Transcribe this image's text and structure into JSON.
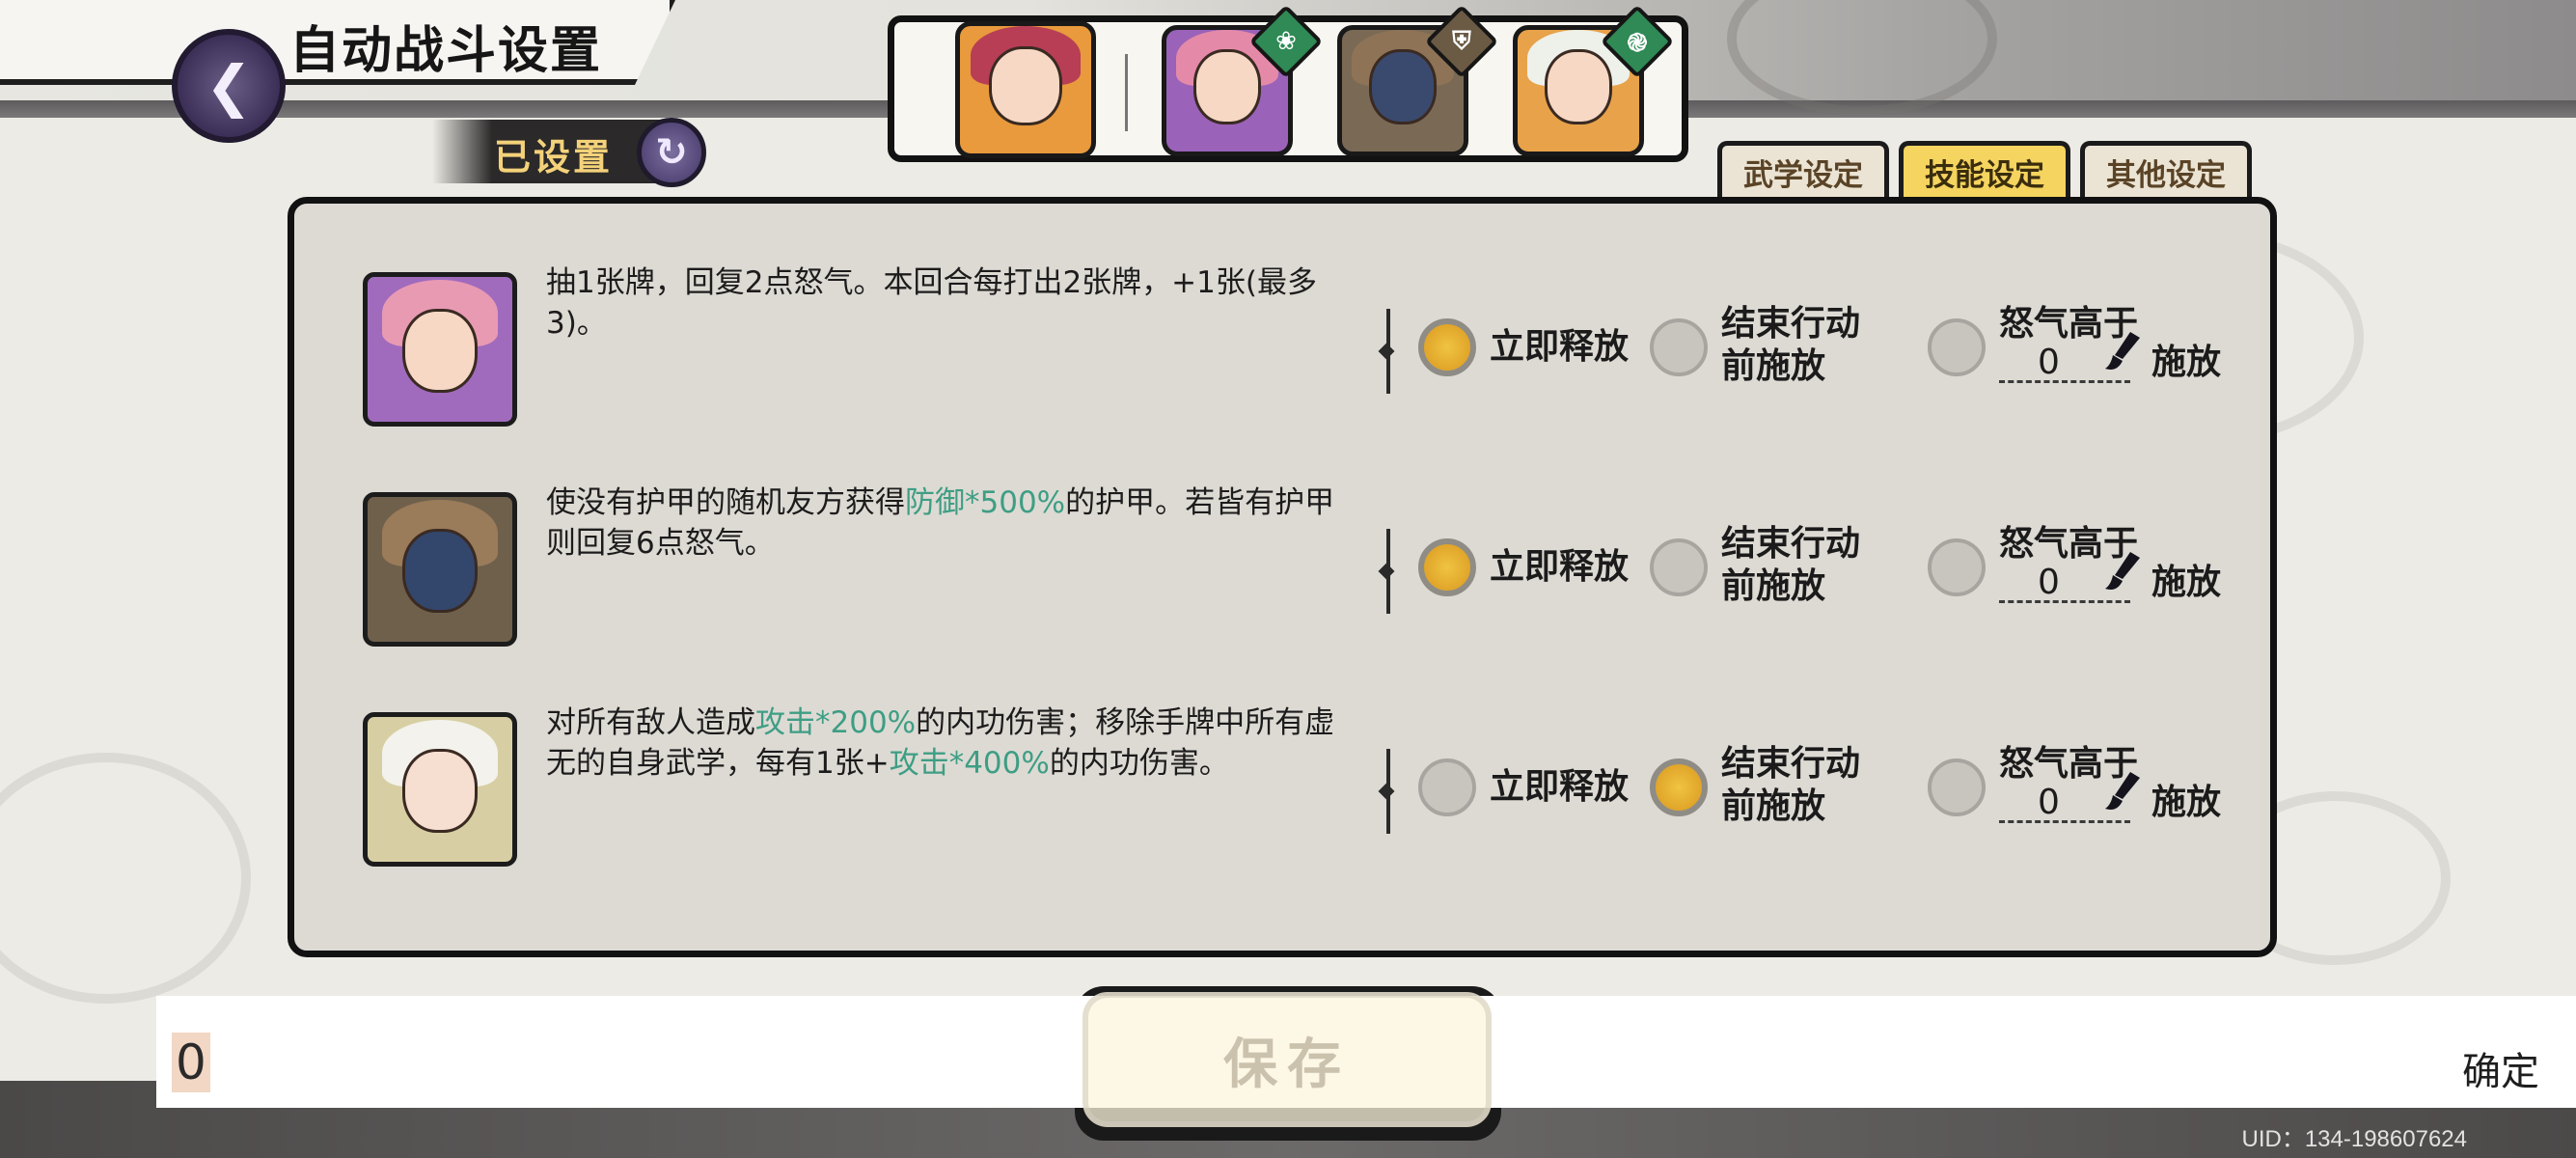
{
  "header": {
    "title": "自动战斗设置",
    "back_icon": "back-swirl-icon"
  },
  "status": {
    "label": "已设置",
    "icon": "swap-cycle-icon"
  },
  "team": {
    "leader": {
      "name_icon": "pink-hair-girl-portrait"
    },
    "members": [
      {
        "portrait": "pink-hair-girl-portrait",
        "badge": "green-leaf-badge",
        "badge_color": "#2f8a55"
      },
      {
        "portrait": "masked-warrior-portrait",
        "badge": "shield-badge",
        "badge_color": "#6b5a44"
      },
      {
        "portrait": "white-hair-girl-portrait",
        "badge": "green-swirl-badge",
        "badge_color": "#2f8a55"
      }
    ]
  },
  "tabs": [
    {
      "label": "武学设定",
      "active": false
    },
    {
      "label": "技能设定",
      "active": true
    },
    {
      "label": "其他设定",
      "active": false
    }
  ],
  "skills": [
    {
      "desc_parts": [
        [
          "抽1张牌，回复2点怒气。本回合每打出2张牌，+1张(最多3)。",
          false
        ]
      ],
      "options": {
        "immediate": "立即释放",
        "end_action": "结束行动前施放",
        "rage_prefix": "怒气高于",
        "rage_value": "0",
        "rage_suffix": "施放"
      },
      "selected": "immediate"
    },
    {
      "desc_parts": [
        [
          "使没有护甲的随机友方获得",
          false
        ],
        [
          "防御*500%",
          true
        ],
        [
          "的护甲。若皆有护甲则回复6点怒气。",
          false
        ]
      ],
      "options": {
        "immediate": "立即释放",
        "end_action": "结束行动前施放",
        "rage_prefix": "怒气高于",
        "rage_value": "0",
        "rage_suffix": "施放"
      },
      "selected": "immediate"
    },
    {
      "desc_parts": [
        [
          "对所有敌人造成",
          false
        ],
        [
          "攻击*200%",
          true
        ],
        [
          "的内功伤害；移除手牌中所有虚无的自身武学，每有1张+",
          false
        ],
        [
          "攻击*400%",
          true
        ],
        [
          "的内功伤害。",
          false
        ]
      ],
      "options": {
        "immediate": "立即释放",
        "end_action": "结束行动前施放",
        "rage_prefix": "怒气高于",
        "rage_value": "0",
        "rage_suffix": "施放"
      },
      "selected": "end_action"
    }
  ],
  "input": {
    "value": "0",
    "confirm": "确定"
  },
  "save": {
    "label": "保存"
  },
  "footer": {
    "uid": "UID：134-198607624"
  },
  "colors": {
    "accent_gold": "#f5d45f",
    "highlight_green": "#3e9e84",
    "panel": "#dddad4"
  }
}
